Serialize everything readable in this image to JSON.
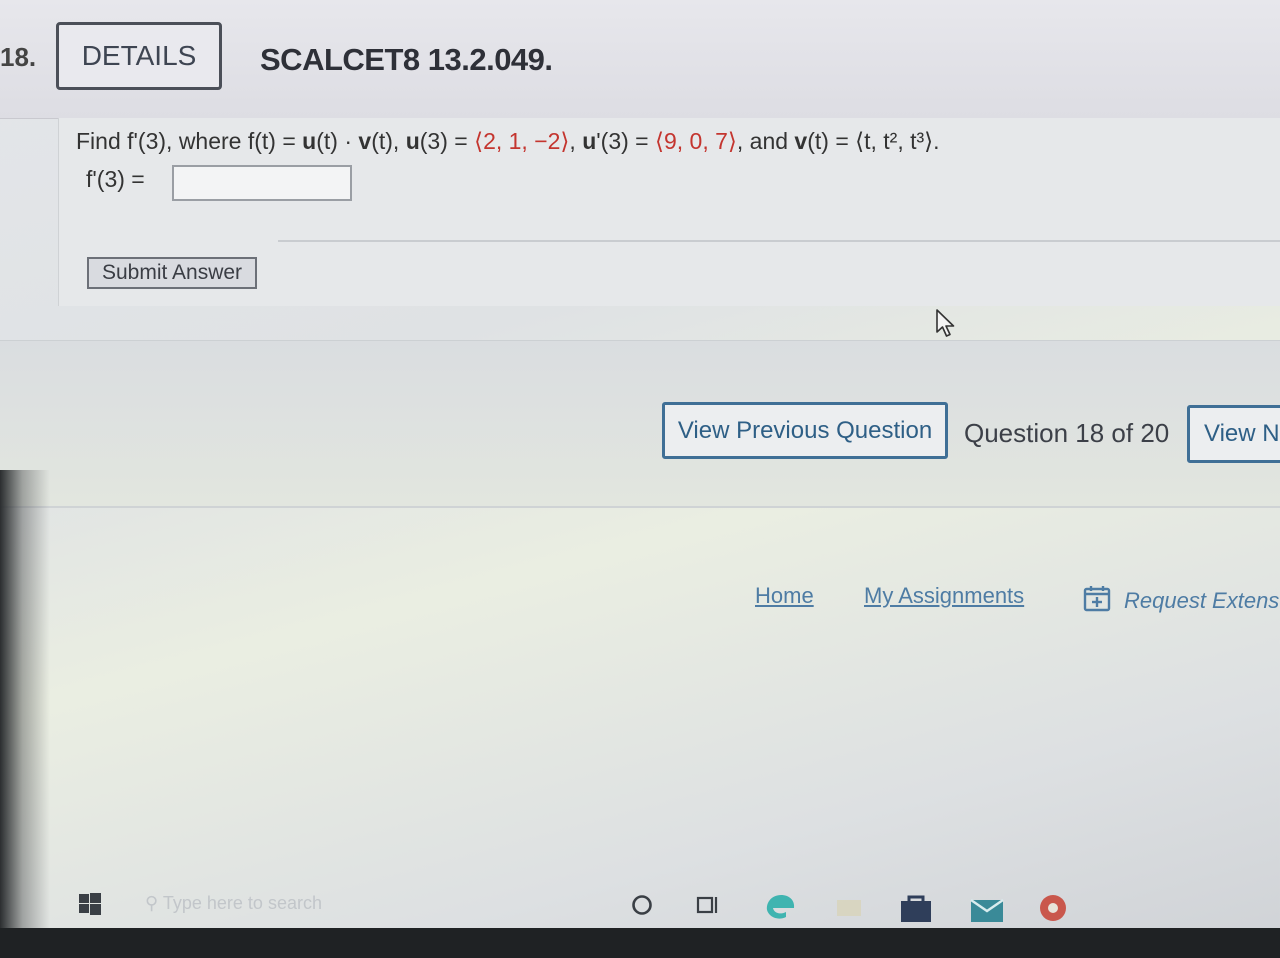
{
  "header": {
    "question_number": "18.",
    "details_label": "DETAILS",
    "question_code": "SCALCET8 13.2.049."
  },
  "problem": {
    "find": "Find",
    "fprime3": "f'(3),",
    "where": "where",
    "ft": "f(t) =",
    "u": "u",
    "ut": "(t)",
    "dot": "·",
    "v": "v",
    "vt": "(t),",
    "u3_label": "u",
    "u3_arg": "(3) =",
    "u3_value": "⟨2, 1, −2⟩",
    "comma1": ",",
    "uprime_label": "u",
    "uprime_arg": "'(3) =",
    "uprime_value": "⟨9, 0, 7⟩",
    "and": ", and",
    "v_label": "v",
    "v_arg": "(t) =",
    "v_value": "⟨t, t², t³⟩."
  },
  "answer": {
    "label": "f'(3) =",
    "value": ""
  },
  "submit_label": "Submit Answer",
  "nav": {
    "prev_label": "View Previous Question",
    "counter": "Question 18 of 20",
    "next_label": "View N"
  },
  "footer": {
    "home": "Home",
    "assignments": "My Assignments",
    "extension": "Request Extens"
  },
  "taskbar": {
    "search_placeholder": "Type here to search"
  },
  "colors": {
    "link": "#4e7ca4",
    "button_border": "#3f6f96",
    "highlight_red": "#c4352f"
  }
}
